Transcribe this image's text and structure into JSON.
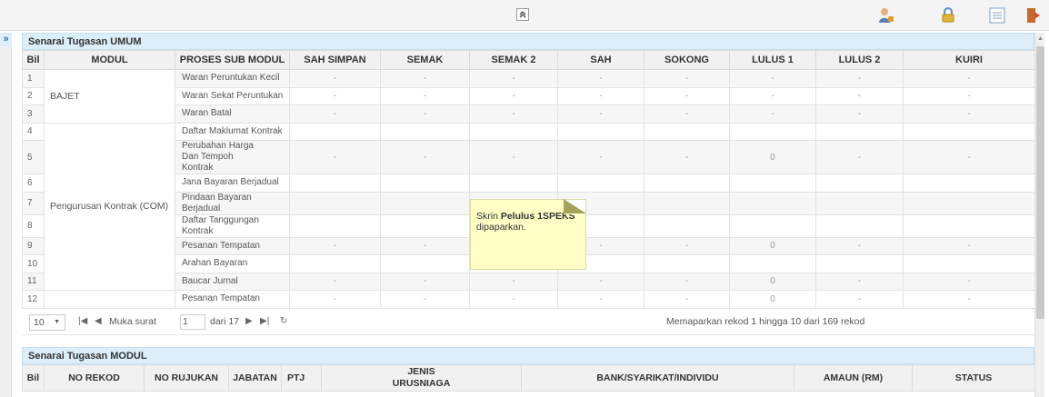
{
  "topbar": {
    "collapse_symbol": "≈",
    "icons": [
      "user-icon",
      "lock-icon",
      "list-icon",
      "logout-icon"
    ]
  },
  "sidebar": {
    "expand_symbol": "»"
  },
  "task_panel": {
    "title": "Senarai Tugasan UMUM",
    "columns": [
      "Bil",
      "MODUL",
      "PROSES SUB MODUL",
      "SAH SIMPAN",
      "SEMAK",
      "SEMAK 2",
      "SAH",
      "SOKONG",
      "LULUS 1",
      "LULUS 2",
      "KUIRI"
    ],
    "rows": [
      {
        "bil": "1",
        "proses": "Waran Peruntukan Kecil",
        "vals": [
          "-",
          "-",
          "-",
          "-",
          "-",
          "-",
          "-",
          "-"
        ]
      },
      {
        "bil": "2",
        "proses": "Waran Sekat Peruntukan",
        "vals": [
          "-",
          "-",
          "-",
          "-",
          "-",
          "-",
          "-",
          "-"
        ]
      },
      {
        "bil": "3",
        "proses": "Waran Batal",
        "vals": [
          "-",
          "-",
          "-",
          "-",
          "-",
          "-",
          "-",
          "-"
        ]
      },
      {
        "bil": "4",
        "proses": "Daftar Maklumat Kontrak",
        "vals": [
          "",
          "",
          "",
          "",
          "",
          "",
          "",
          ""
        ]
      },
      {
        "bil": "5",
        "proses": "Perubahan Harga Dan Tempoh Kontrak",
        "vals": [
          "-",
          "-",
          "-",
          "-",
          "-",
          "0",
          "-",
          "-"
        ]
      },
      {
        "bil": "6",
        "proses": "Jana Bayaran Berjadual",
        "vals": [
          "",
          "",
          "",
          "",
          "",
          "",
          "",
          ""
        ]
      },
      {
        "bil": "7",
        "proses": "Pindaan Bayaran Berjadual",
        "vals": [
          "",
          "",
          "",
          "",
          "",
          "",
          "",
          ""
        ]
      },
      {
        "bil": "8",
        "proses": "Daftar Tanggungan Kontrak",
        "vals": [
          "",
          "",
          "",
          "",
          "",
          "",
          "",
          ""
        ]
      },
      {
        "bil": "9",
        "proses": "Pesanan Tempatan",
        "vals": [
          "-",
          "-",
          "",
          "-",
          "-",
          "0",
          "-",
          "-"
        ]
      },
      {
        "bil": "10",
        "proses": "Arahan Bayaran",
        "vals": [
          "",
          "",
          "",
          "",
          "",
          "",
          "",
          ""
        ]
      },
      {
        "bil": "11",
        "proses": "Baucar Jurnal",
        "vals": [
          "-",
          "-",
          "-",
          "-",
          "-",
          "0",
          "-",
          "-"
        ]
      },
      {
        "bil": "12",
        "proses": "Pesanan Tempatan",
        "vals": [
          "-",
          "-",
          "-",
          "-",
          "-",
          "0",
          "-",
          "-"
        ]
      }
    ],
    "modul_groups": [
      {
        "label": "BAJET"
      },
      {
        "label": "Pengurusan Kontrak (COM)"
      }
    ]
  },
  "pager": {
    "page_size": "10",
    "page_label": "Muka surat",
    "page_value": "1",
    "of_label": "dari 17",
    "summary": "Memaparkan rekod 1 hingga 10 dari 169 rekod"
  },
  "module_panel": {
    "title": "Senarai Tugasan MODUL",
    "columns": [
      "Bil",
      "NO REKOD",
      "NO RUJUKAN",
      "JABATAN",
      "PTJ",
      "JENIS URUSNIAGA",
      "BANK/SYARIKAT/INDIVIDU",
      "AMAUN (RM)",
      "STATUS"
    ]
  },
  "tooltip": {
    "text_pre": "Skrin ",
    "text_bold": "Pelulus 1SPEKS",
    "text_post": " dipaparkan."
  }
}
